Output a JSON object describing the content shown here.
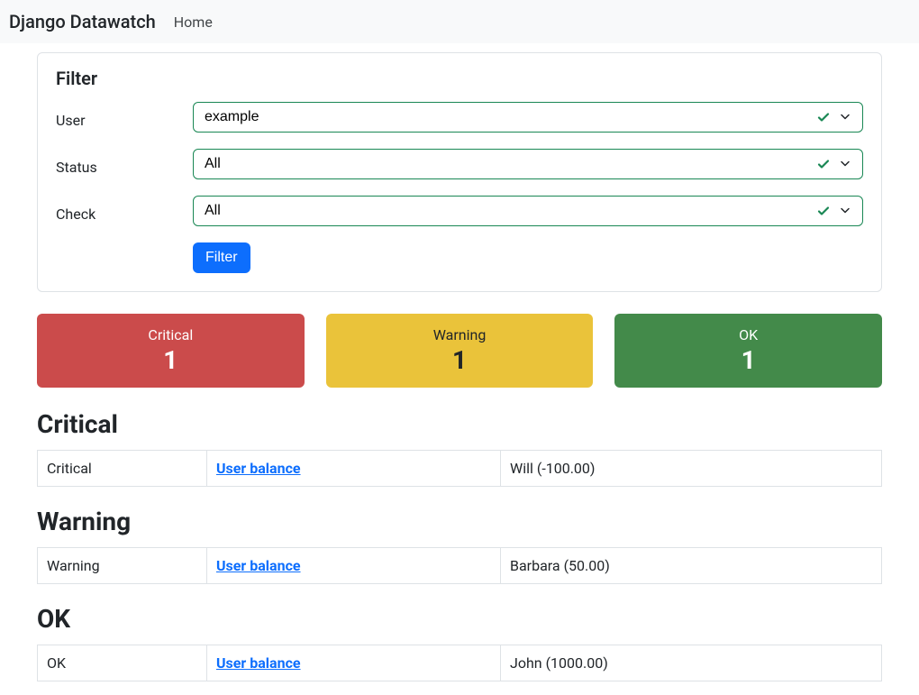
{
  "nav": {
    "brand": "Django Datawatch",
    "home_label": "Home"
  },
  "filter": {
    "title": "Filter",
    "user_label": "User",
    "user_value": "example",
    "status_label": "Status",
    "status_value": "All",
    "check_label": "Check",
    "check_value": "All",
    "button_label": "Filter"
  },
  "cards": {
    "critical": {
      "label": "Critical",
      "count": "1"
    },
    "warning": {
      "label": "Warning",
      "count": "1"
    },
    "ok": {
      "label": "OK",
      "count": "1"
    }
  },
  "sections": {
    "critical": {
      "title": "Critical",
      "row": {
        "status": "Critical",
        "check": "User balance",
        "payload": "Will (-100.00)"
      }
    },
    "warning": {
      "title": "Warning",
      "row": {
        "status": "Warning",
        "check": "User balance",
        "payload": "Barbara (50.00)"
      }
    },
    "ok": {
      "title": "OK",
      "row": {
        "status": "OK",
        "check": "User balance",
        "payload": "John (1000.00)"
      }
    }
  }
}
